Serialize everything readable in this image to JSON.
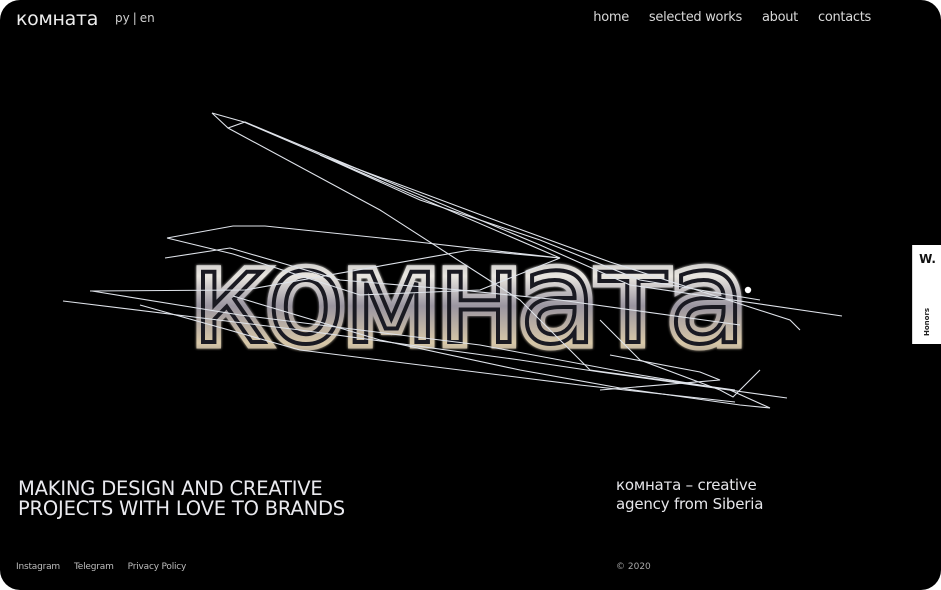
{
  "header": {
    "logo": "комната",
    "languages": [
      "ру",
      "en"
    ],
    "language_separator": "|",
    "nav": [
      {
        "label": "home"
      },
      {
        "label": "selected works"
      },
      {
        "label": "about"
      },
      {
        "label": "contacts"
      }
    ]
  },
  "hero": {
    "wordmark": "комната",
    "wordmark_color": "#c9c9d2",
    "line_color": "#dfe3ea"
  },
  "tagline": {
    "line1": "MAKING DESIGN AND CREATIVE",
    "line2": "PROJECTS WITH LOVE TO BRANDS"
  },
  "about": {
    "line1": "комната – creative",
    "line2": "agency from Siberia"
  },
  "footer": {
    "links": [
      {
        "label": "Instagram"
      },
      {
        "label": "Telegram"
      },
      {
        "label": "Privacy Policy"
      }
    ],
    "copyright": "© 2020"
  },
  "honors_badge": {
    "mark": "W.",
    "label": "Honors"
  },
  "colors": {
    "background": "#000000",
    "text": "#e9e9ee",
    "badge_bg": "#ffffff"
  }
}
